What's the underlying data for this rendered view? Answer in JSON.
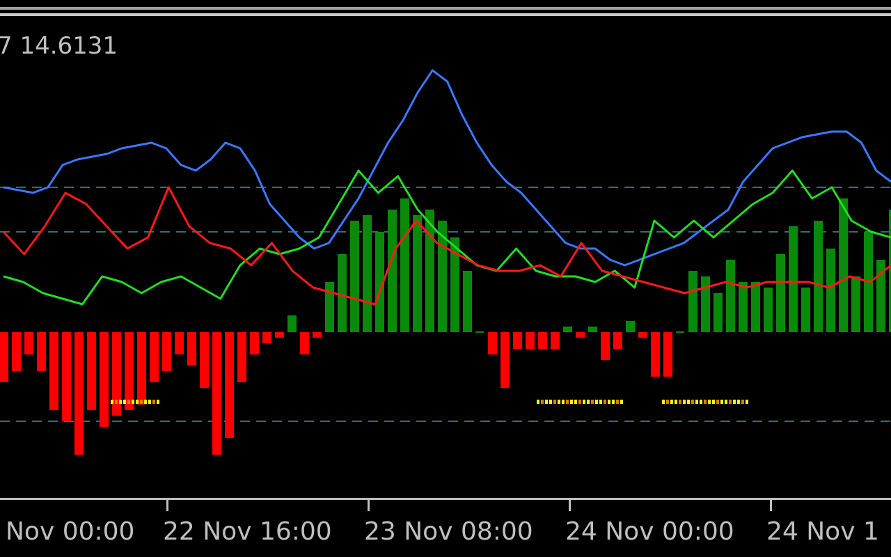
{
  "indicator_label": "7 14.6131",
  "colors": {
    "background": "#000000",
    "frame": "#c0c0c0",
    "level": "#2f6f73",
    "hist_pos": "#0a8a0a",
    "hist_neg": "#ff0000",
    "blue": "#3a78ff",
    "green": "#22dd22",
    "red": "#ff1a1a",
    "dot_yellow": "#ffff00",
    "dot_orange": "#e08000",
    "text": "#c0c0c0"
  },
  "chart_data": {
    "type": "bar",
    "x_tick_labels": [
      "Nov 00:00",
      "22 Nov 16:00",
      "23 Nov 08:00",
      "24 Nov 00:00",
      "24 Nov 1"
    ],
    "x_tick_index": [
      13.5,
      29.5,
      45.5,
      61.5
    ],
    "levels": [
      26,
      18,
      -16
    ],
    "ylim": [
      -28,
      47
    ],
    "histogram": [
      -9,
      -7,
      -4,
      -7,
      -14,
      -16,
      -22,
      -14,
      -17,
      -15,
      -14,
      -13,
      -9,
      -7,
      -4,
      -6,
      -10,
      -22,
      -19,
      -9,
      -4,
      -2,
      -1,
      3,
      -4,
      -1,
      9,
      14,
      20,
      21,
      18,
      22,
      24,
      21,
      22,
      20,
      17,
      11,
      0,
      -4,
      -10,
      -3,
      -3,
      -3,
      -3,
      1,
      -1,
      1,
      -5,
      -3,
      2,
      -1,
      -8,
      -8,
      0,
      11,
      10,
      7,
      13,
      9,
      9,
      8,
      14,
      19,
      8,
      20,
      15,
      24,
      10,
      18,
      13,
      22,
      16,
      14,
      8,
      8,
      2
    ],
    "signal_dots": [
      {
        "from_index": 9,
        "to_index": 12,
        "value": -12.5
      },
      {
        "from_index": 43,
        "to_index": 49,
        "value": -12.5
      },
      {
        "from_index": 53,
        "to_index": 59,
        "value": -12.5
      }
    ],
    "series": [
      {
        "color": "blue",
        "values": [
          26,
          25.5,
          25,
          26,
          30,
          31,
          31.5,
          32,
          33,
          33.5,
          34,
          33,
          30,
          29,
          31,
          34,
          33,
          29,
          23,
          20,
          17,
          15,
          16,
          20,
          24,
          29,
          34,
          38,
          43,
          47,
          45,
          39,
          34,
          30,
          27,
          25,
          22,
          19,
          16,
          15,
          15,
          13,
          12,
          13,
          14,
          15,
          16,
          18,
          20,
          22,
          27,
          30,
          33,
          34,
          35,
          35.5,
          36,
          36,
          34,
          29,
          27
        ]
      },
      {
        "color": "green",
        "values": [
          10,
          9,
          7,
          6,
          5,
          10,
          9,
          7,
          9,
          10,
          8,
          6,
          12,
          15,
          14,
          15,
          17,
          23,
          29,
          25,
          28,
          22,
          18,
          15,
          12,
          11,
          15,
          11,
          10,
          10,
          9,
          11,
          8,
          20,
          17,
          20,
          17,
          20,
          23,
          25,
          29,
          24,
          26,
          20,
          18,
          17
        ]
      },
      {
        "color": "red",
        "values": [
          18,
          14,
          19,
          25,
          23,
          19,
          15,
          17,
          26,
          19,
          16,
          15,
          12,
          16,
          11,
          8,
          7,
          6,
          5,
          15,
          20,
          16,
          14,
          12,
          11,
          11,
          12,
          10,
          16,
          11,
          10,
          9,
          8,
          7,
          8,
          9,
          8,
          9,
          9,
          9,
          8,
          10,
          9,
          12
        ]
      }
    ]
  }
}
